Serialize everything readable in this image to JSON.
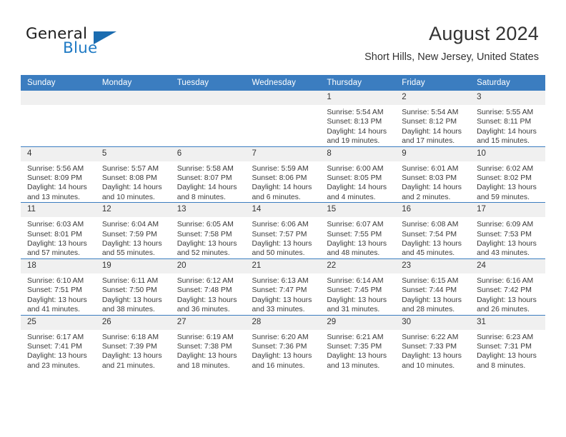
{
  "brand": {
    "name_part1": "General",
    "name_part2": "Blue",
    "logo_icon": "triangle-logo-icon",
    "accent_color": "#1b6cb0"
  },
  "header": {
    "title": "August 2024",
    "location": "Short Hills, New Jersey, United States"
  },
  "theme": {
    "header_row_bg": "#3b7dc0",
    "daynum_bg": "#f0f0f0",
    "grid_line": "#3b7dc0"
  },
  "calendar": {
    "weekday_headers": [
      "Sunday",
      "Monday",
      "Tuesday",
      "Wednesday",
      "Thursday",
      "Friday",
      "Saturday"
    ],
    "weeks": [
      [
        {
          "day": "",
          "sunrise": "",
          "sunset": "",
          "daylight_line1": "",
          "daylight_line2": ""
        },
        {
          "day": "",
          "sunrise": "",
          "sunset": "",
          "daylight_line1": "",
          "daylight_line2": ""
        },
        {
          "day": "",
          "sunrise": "",
          "sunset": "",
          "daylight_line1": "",
          "daylight_line2": ""
        },
        {
          "day": "",
          "sunrise": "",
          "sunset": "",
          "daylight_line1": "",
          "daylight_line2": ""
        },
        {
          "day": "1",
          "sunrise": "Sunrise: 5:54 AM",
          "sunset": "Sunset: 8:13 PM",
          "daylight_line1": "Daylight: 14 hours",
          "daylight_line2": "and 19 minutes."
        },
        {
          "day": "2",
          "sunrise": "Sunrise: 5:54 AM",
          "sunset": "Sunset: 8:12 PM",
          "daylight_line1": "Daylight: 14 hours",
          "daylight_line2": "and 17 minutes."
        },
        {
          "day": "3",
          "sunrise": "Sunrise: 5:55 AM",
          "sunset": "Sunset: 8:11 PM",
          "daylight_line1": "Daylight: 14 hours",
          "daylight_line2": "and 15 minutes."
        }
      ],
      [
        {
          "day": "4",
          "sunrise": "Sunrise: 5:56 AM",
          "sunset": "Sunset: 8:09 PM",
          "daylight_line1": "Daylight: 14 hours",
          "daylight_line2": "and 13 minutes."
        },
        {
          "day": "5",
          "sunrise": "Sunrise: 5:57 AM",
          "sunset": "Sunset: 8:08 PM",
          "daylight_line1": "Daylight: 14 hours",
          "daylight_line2": "and 10 minutes."
        },
        {
          "day": "6",
          "sunrise": "Sunrise: 5:58 AM",
          "sunset": "Sunset: 8:07 PM",
          "daylight_line1": "Daylight: 14 hours",
          "daylight_line2": "and 8 minutes."
        },
        {
          "day": "7",
          "sunrise": "Sunrise: 5:59 AM",
          "sunset": "Sunset: 8:06 PM",
          "daylight_line1": "Daylight: 14 hours",
          "daylight_line2": "and 6 minutes."
        },
        {
          "day": "8",
          "sunrise": "Sunrise: 6:00 AM",
          "sunset": "Sunset: 8:05 PM",
          "daylight_line1": "Daylight: 14 hours",
          "daylight_line2": "and 4 minutes."
        },
        {
          "day": "9",
          "sunrise": "Sunrise: 6:01 AM",
          "sunset": "Sunset: 8:03 PM",
          "daylight_line1": "Daylight: 14 hours",
          "daylight_line2": "and 2 minutes."
        },
        {
          "day": "10",
          "sunrise": "Sunrise: 6:02 AM",
          "sunset": "Sunset: 8:02 PM",
          "daylight_line1": "Daylight: 13 hours",
          "daylight_line2": "and 59 minutes."
        }
      ],
      [
        {
          "day": "11",
          "sunrise": "Sunrise: 6:03 AM",
          "sunset": "Sunset: 8:01 PM",
          "daylight_line1": "Daylight: 13 hours",
          "daylight_line2": "and 57 minutes."
        },
        {
          "day": "12",
          "sunrise": "Sunrise: 6:04 AM",
          "sunset": "Sunset: 7:59 PM",
          "daylight_line1": "Daylight: 13 hours",
          "daylight_line2": "and 55 minutes."
        },
        {
          "day": "13",
          "sunrise": "Sunrise: 6:05 AM",
          "sunset": "Sunset: 7:58 PM",
          "daylight_line1": "Daylight: 13 hours",
          "daylight_line2": "and 52 minutes."
        },
        {
          "day": "14",
          "sunrise": "Sunrise: 6:06 AM",
          "sunset": "Sunset: 7:57 PM",
          "daylight_line1": "Daylight: 13 hours",
          "daylight_line2": "and 50 minutes."
        },
        {
          "day": "15",
          "sunrise": "Sunrise: 6:07 AM",
          "sunset": "Sunset: 7:55 PM",
          "daylight_line1": "Daylight: 13 hours",
          "daylight_line2": "and 48 minutes."
        },
        {
          "day": "16",
          "sunrise": "Sunrise: 6:08 AM",
          "sunset": "Sunset: 7:54 PM",
          "daylight_line1": "Daylight: 13 hours",
          "daylight_line2": "and 45 minutes."
        },
        {
          "day": "17",
          "sunrise": "Sunrise: 6:09 AM",
          "sunset": "Sunset: 7:53 PM",
          "daylight_line1": "Daylight: 13 hours",
          "daylight_line2": "and 43 minutes."
        }
      ],
      [
        {
          "day": "18",
          "sunrise": "Sunrise: 6:10 AM",
          "sunset": "Sunset: 7:51 PM",
          "daylight_line1": "Daylight: 13 hours",
          "daylight_line2": "and 41 minutes."
        },
        {
          "day": "19",
          "sunrise": "Sunrise: 6:11 AM",
          "sunset": "Sunset: 7:50 PM",
          "daylight_line1": "Daylight: 13 hours",
          "daylight_line2": "and 38 minutes."
        },
        {
          "day": "20",
          "sunrise": "Sunrise: 6:12 AM",
          "sunset": "Sunset: 7:48 PM",
          "daylight_line1": "Daylight: 13 hours",
          "daylight_line2": "and 36 minutes."
        },
        {
          "day": "21",
          "sunrise": "Sunrise: 6:13 AM",
          "sunset": "Sunset: 7:47 PM",
          "daylight_line1": "Daylight: 13 hours",
          "daylight_line2": "and 33 minutes."
        },
        {
          "day": "22",
          "sunrise": "Sunrise: 6:14 AM",
          "sunset": "Sunset: 7:45 PM",
          "daylight_line1": "Daylight: 13 hours",
          "daylight_line2": "and 31 minutes."
        },
        {
          "day": "23",
          "sunrise": "Sunrise: 6:15 AM",
          "sunset": "Sunset: 7:44 PM",
          "daylight_line1": "Daylight: 13 hours",
          "daylight_line2": "and 28 minutes."
        },
        {
          "day": "24",
          "sunrise": "Sunrise: 6:16 AM",
          "sunset": "Sunset: 7:42 PM",
          "daylight_line1": "Daylight: 13 hours",
          "daylight_line2": "and 26 minutes."
        }
      ],
      [
        {
          "day": "25",
          "sunrise": "Sunrise: 6:17 AM",
          "sunset": "Sunset: 7:41 PM",
          "daylight_line1": "Daylight: 13 hours",
          "daylight_line2": "and 23 minutes."
        },
        {
          "day": "26",
          "sunrise": "Sunrise: 6:18 AM",
          "sunset": "Sunset: 7:39 PM",
          "daylight_line1": "Daylight: 13 hours",
          "daylight_line2": "and 21 minutes."
        },
        {
          "day": "27",
          "sunrise": "Sunrise: 6:19 AM",
          "sunset": "Sunset: 7:38 PM",
          "daylight_line1": "Daylight: 13 hours",
          "daylight_line2": "and 18 minutes."
        },
        {
          "day": "28",
          "sunrise": "Sunrise: 6:20 AM",
          "sunset": "Sunset: 7:36 PM",
          "daylight_line1": "Daylight: 13 hours",
          "daylight_line2": "and 16 minutes."
        },
        {
          "day": "29",
          "sunrise": "Sunrise: 6:21 AM",
          "sunset": "Sunset: 7:35 PM",
          "daylight_line1": "Daylight: 13 hours",
          "daylight_line2": "and 13 minutes."
        },
        {
          "day": "30",
          "sunrise": "Sunrise: 6:22 AM",
          "sunset": "Sunset: 7:33 PM",
          "daylight_line1": "Daylight: 13 hours",
          "daylight_line2": "and 10 minutes."
        },
        {
          "day": "31",
          "sunrise": "Sunrise: 6:23 AM",
          "sunset": "Sunset: 7:31 PM",
          "daylight_line1": "Daylight: 13 hours",
          "daylight_line2": "and 8 minutes."
        }
      ]
    ]
  }
}
